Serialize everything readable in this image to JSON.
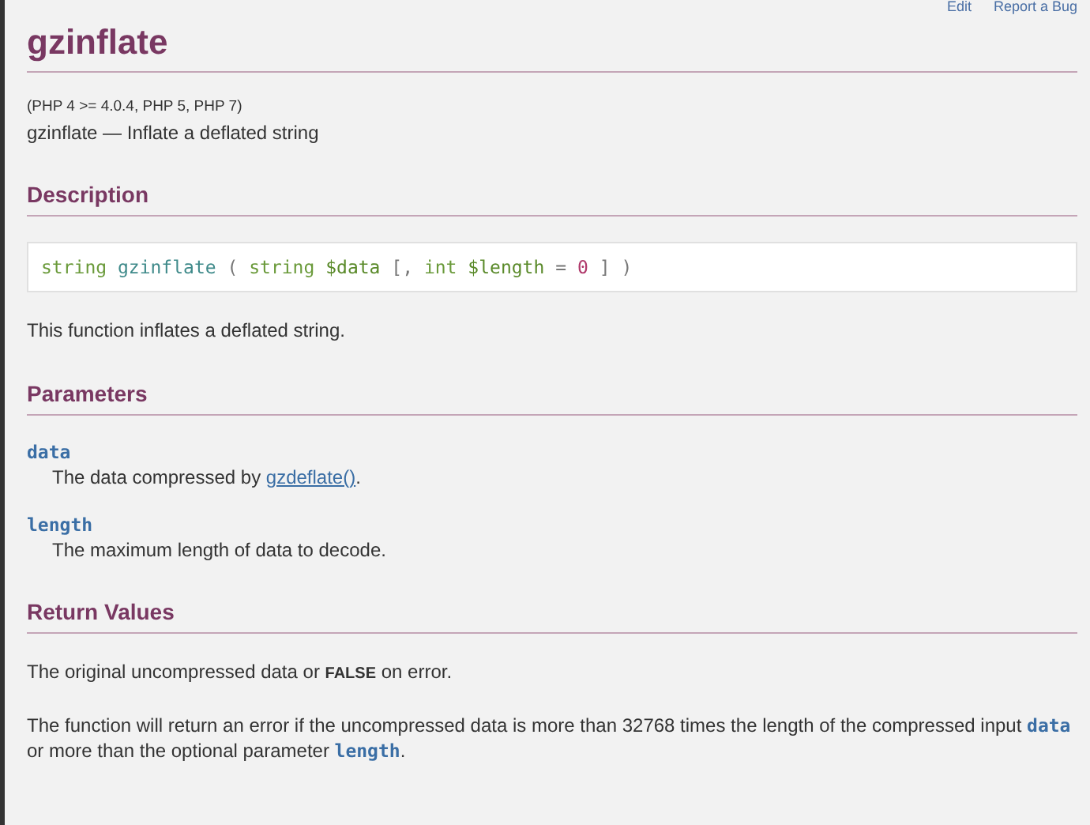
{
  "top_links": [
    "Edit",
    "Report a Bug"
  ],
  "title": "gzinflate",
  "version": "(PHP 4 >= 4.0.4, PHP 5, PHP 7)",
  "purpose": "gzinflate — Inflate a deflated string",
  "sections": [
    {
      "heading": "Description",
      "blocks": [
        {
          "kind": "signature",
          "tokens": [
            {
              "kind": "type",
              "text": "string"
            },
            {
              "kind": "name",
              "text": "gzinflate"
            },
            {
              "kind": "punct",
              "text": "("
            },
            {
              "kind": "type",
              "text": "string"
            },
            {
              "kind": "var",
              "text": "$data"
            },
            {
              "kind": "punct",
              "text": "[,"
            },
            {
              "kind": "type",
              "text": "int"
            },
            {
              "kind": "var",
              "text": "$length"
            },
            {
              "kind": "punct",
              "text": "="
            },
            {
              "kind": "number",
              "text": "0"
            },
            {
              "kind": "punct",
              "text": "]"
            },
            {
              "kind": "punct",
              "text": ")"
            }
          ]
        },
        {
          "kind": "para",
          "segments": [
            {
              "kind": "text",
              "text": "This function inflates a deflated string."
            }
          ]
        }
      ]
    },
    {
      "heading": "Parameters",
      "blocks": [
        {
          "kind": "param",
          "name": "data",
          "segments": [
            {
              "kind": "text",
              "text": "The data compressed by "
            },
            {
              "kind": "link",
              "text": "gzdeflate()"
            },
            {
              "kind": "text",
              "text": "."
            }
          ]
        },
        {
          "kind": "param",
          "name": "length",
          "segments": [
            {
              "kind": "text",
              "text": "The maximum length of data to decode."
            }
          ]
        }
      ]
    },
    {
      "heading": "Return Values",
      "blocks": [
        {
          "kind": "para",
          "segments": [
            {
              "kind": "text",
              "text": "The original uncompressed data or "
            },
            {
              "kind": "const",
              "text": "FALSE"
            },
            {
              "kind": "text",
              "text": " on error."
            }
          ]
        },
        {
          "kind": "para",
          "segments": [
            {
              "kind": "text",
              "text": "The function will return an error if the uncompressed data is more than 32768 times the length of the compressed input "
            },
            {
              "kind": "code",
              "text": "data"
            },
            {
              "kind": "text",
              "text": " or more than the optional parameter "
            },
            {
              "kind": "code",
              "text": "length"
            },
            {
              "kind": "text",
              "text": "."
            }
          ]
        }
      ]
    }
  ]
}
